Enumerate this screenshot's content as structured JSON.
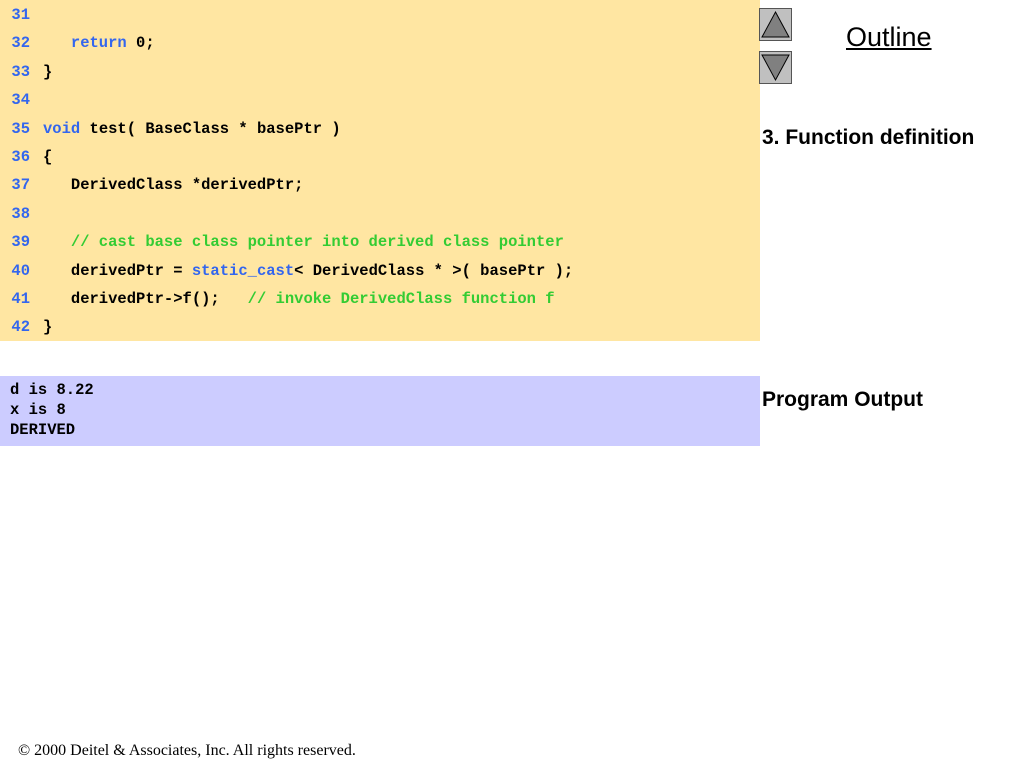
{
  "code": {
    "lines": [
      {
        "num": "31",
        "parts": []
      },
      {
        "num": "32",
        "parts": [
          {
            "t": "   ",
            "c": ""
          },
          {
            "t": "return",
            "c": "kw"
          },
          {
            "t": " 0;",
            "c": ""
          }
        ]
      },
      {
        "num": "33",
        "parts": [
          {
            "t": "}",
            "c": ""
          }
        ]
      },
      {
        "num": "34",
        "parts": []
      },
      {
        "num": "35",
        "parts": [
          {
            "t": "void",
            "c": "kw"
          },
          {
            "t": " test( BaseClass * basePtr )",
            "c": ""
          }
        ]
      },
      {
        "num": "36",
        "parts": [
          {
            "t": "{",
            "c": ""
          }
        ]
      },
      {
        "num": "37",
        "parts": [
          {
            "t": "   DerivedClass *derivedPtr;",
            "c": ""
          }
        ]
      },
      {
        "num": "38",
        "parts": []
      },
      {
        "num": "39",
        "parts": [
          {
            "t": "   ",
            "c": ""
          },
          {
            "t": "// cast base class pointer into derived class pointer",
            "c": "cm"
          }
        ]
      },
      {
        "num": "40",
        "parts": [
          {
            "t": "   derivedPtr = ",
            "c": ""
          },
          {
            "t": "static_cast",
            "c": "kw"
          },
          {
            "t": "< DerivedClass * >( basePtr );",
            "c": ""
          }
        ]
      },
      {
        "num": "41",
        "parts": [
          {
            "t": "   derivedPtr->f();   ",
            "c": ""
          },
          {
            "t": "// invoke DerivedClass function f",
            "c": "cm"
          }
        ]
      },
      {
        "num": "42",
        "parts": [
          {
            "t": "}",
            "c": ""
          }
        ]
      }
    ]
  },
  "output": {
    "lines": [
      "d is 8.22",
      "x is 8",
      "DERIVED"
    ]
  },
  "nav": {
    "up_icon": "triangle-up-icon",
    "down_icon": "triangle-down-icon"
  },
  "sidebar": {
    "outline_label": "Outline",
    "section_label": "3. Function definition",
    "output_label": "Program Output"
  },
  "footer": {
    "copyright": "© 2000 Deitel & Associates, Inc.  All rights reserved."
  },
  "colors": {
    "code_bg": "#ffe6a2",
    "output_bg": "#ccccff",
    "keyword": "#3366ee",
    "comment": "#33cc33"
  }
}
